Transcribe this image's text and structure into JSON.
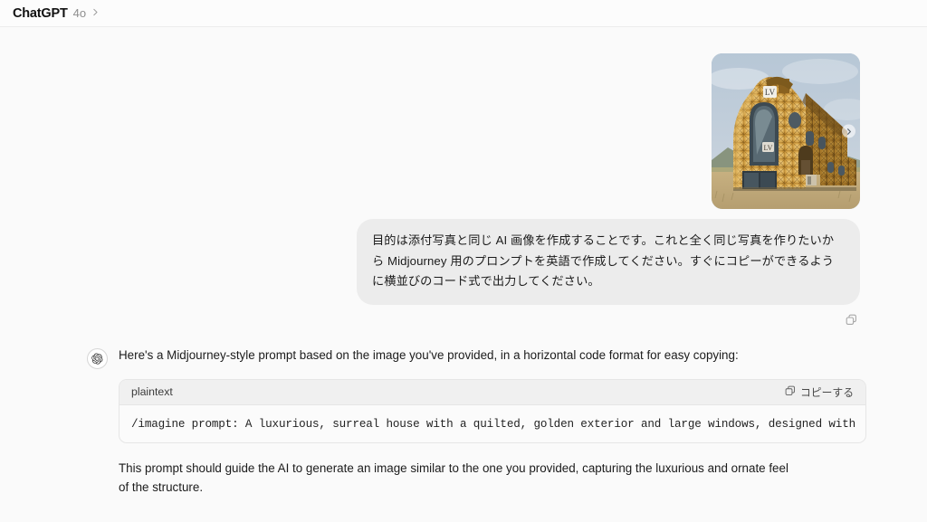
{
  "header": {
    "app_title": "ChatGPT",
    "model_label": "4o",
    "chevron_icon": "chevron-right-icon"
  },
  "conversation": {
    "user": {
      "attachment": {
        "icon": "attached-image-thumbnail",
        "alt": "Surreal house with quilted golden exterior and large arched windows",
        "next_badge_icon": "chevron-right-circle-icon"
      },
      "message": "目的は添付写真と同じ AI 画像を作成することです。これと全く同じ写真を作りたいから Midjourney 用のプロンプトを英語で作成してください。すぐにコピーができるように横並びのコード式で出力してください。",
      "copy_icon": "copy-icon"
    },
    "assistant": {
      "avatar_icon": "openai-logo-icon",
      "intro": "Here's a Midjourney-style prompt based on the image you've provided, in a horizontal code format for easy copying:",
      "code_block": {
        "language_label": "plaintext",
        "copy_label": "コピーする",
        "copy_icon": "copy-icon",
        "code": "/imagine prompt: A luxurious, surreal house with a quilted, golden exterior and large windows, designed with"
      },
      "outro": "This prompt should guide the AI to generate an image similar to the one you provided, capturing the luxurious and ornate feel of the structure."
    }
  },
  "colors": {
    "page_background": "#fafafa",
    "header_background": "#fcfcfc",
    "user_bubble": "#ececec",
    "code_header": "#f0f0f0",
    "code_body": "#fbfbfb",
    "border": "#e6e6e6",
    "text_primary": "#1b1b1b",
    "text_muted": "#8e8e8e"
  }
}
